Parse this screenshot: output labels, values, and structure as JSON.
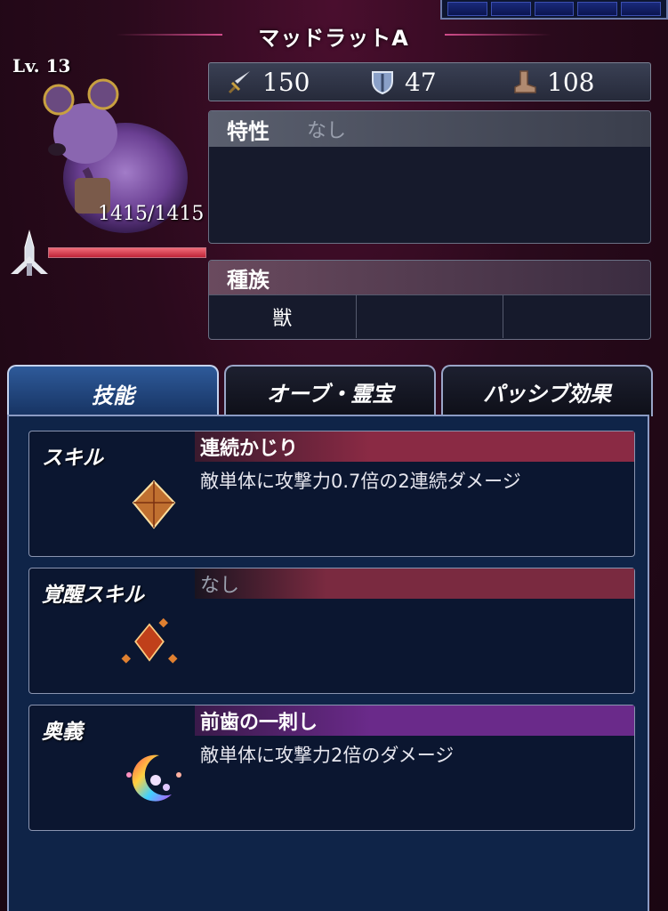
{
  "title": "マッドラットA",
  "level": "Lv. 13",
  "hp": "1415/1415",
  "hp_fraction": 1.0,
  "stats": [
    {
      "icon": "sword-icon",
      "value": "150"
    },
    {
      "icon": "shield-icon",
      "value": "47"
    },
    {
      "icon": "boot-icon",
      "value": "108"
    }
  ],
  "trait": {
    "label": "特性",
    "value": "なし"
  },
  "tribe": {
    "label": "種族",
    "cells": [
      "獣",
      "",
      ""
    ]
  },
  "tabs": [
    "技能",
    "オーブ・霊宝",
    "パッシブ効果"
  ],
  "skills": [
    {
      "label": "スキル",
      "name": "連続かじり",
      "desc": "敵単体に攻撃力0.7倍の2連続ダメージ"
    },
    {
      "label": "覚醒スキル",
      "name": "なし",
      "desc": ""
    },
    {
      "label": "奥義",
      "name": "前歯の一刺し",
      "desc": "敵単体に攻撃力2倍のダメージ"
    }
  ],
  "colors": {
    "hp": "#e0384c",
    "active_tab": "#2e5a9a",
    "skill_bar": "#8a2a44",
    "ougi_bar": "#6a2a8a"
  }
}
